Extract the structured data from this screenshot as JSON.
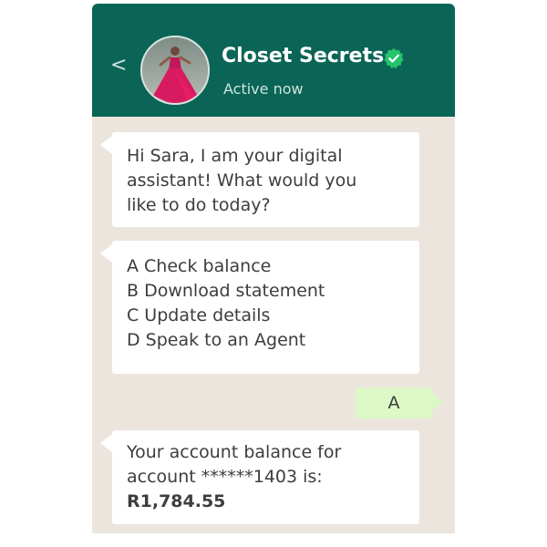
{
  "header": {
    "back_glyph": "<",
    "title": "Closet Secrets",
    "status": "Active now",
    "verified_color": "#25c36b",
    "background_color": "#0b6556"
  },
  "messages": [
    {
      "direction": "incoming",
      "lines": [
        "Hi Sara, I am your digital",
        "assistant! What would you",
        "like to do today?"
      ]
    },
    {
      "direction": "incoming",
      "lines": [
        "A Check balance",
        "B Download statement",
        "C Update details",
        "D Speak to an Agent"
      ]
    },
    {
      "direction": "outgoing",
      "text": "A"
    },
    {
      "direction": "incoming",
      "lines": [
        "Your account balance for",
        "account ******1403 is:"
      ],
      "amount": "R1,784.55"
    }
  ],
  "chat_background_color": "#ece5dd",
  "outgoing_bubble_color": "#dcf8c6"
}
